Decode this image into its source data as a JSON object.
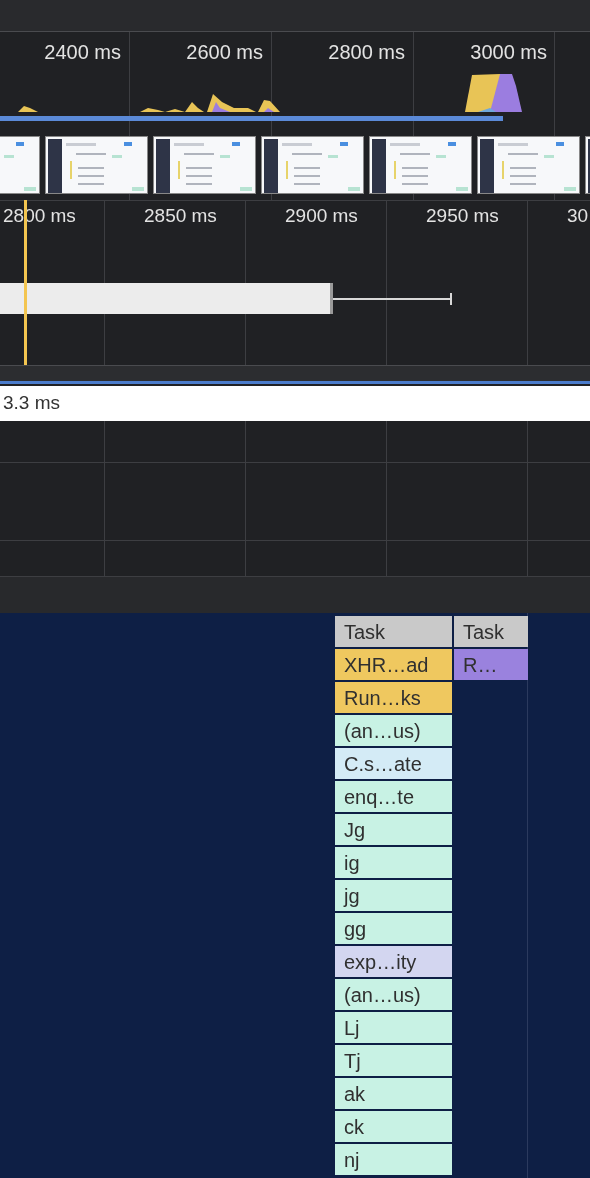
{
  "overview": {
    "ticks": [
      "2400 ms",
      "2600 ms",
      "2800 ms",
      "3000 ms"
    ],
    "progress": {
      "level": 0.853
    },
    "filmstrip": [
      {
        "kind": "picture"
      },
      {
        "kind": "picture"
      },
      {
        "kind": "picture"
      },
      {
        "kind": "picture"
      },
      {
        "kind": "picture"
      },
      {
        "kind": "picture"
      },
      {
        "kind": "picture"
      }
    ]
  },
  "ruler": {
    "ticks": [
      "2800 ms",
      "2850 ms",
      "2900 ms",
      "2950 ms",
      "30"
    ]
  },
  "timing": {
    "label": "3.3 ms"
  },
  "flame": {
    "columns": [
      {
        "entries": [
          {
            "label": "Task",
            "color": "#c9c9c9"
          },
          {
            "label": "XHR…ad",
            "color": "#efc85f"
          },
          {
            "label": "Run…ks",
            "color": "#efc85f"
          },
          {
            "label": "(an…us)",
            "color": "#c8f2e4"
          },
          {
            "label": "C.s…ate",
            "color": "#d4ebf6"
          },
          {
            "label": "enq…te",
            "color": "#c8f2e4"
          },
          {
            "label": "Jg",
            "color": "#c8f2e4"
          },
          {
            "label": "ig",
            "color": "#c8f2e4"
          },
          {
            "label": "jg",
            "color": "#c8f2e4"
          },
          {
            "label": "gg",
            "color": "#c8f2e4"
          },
          {
            "label": "exp…ity",
            "color": "#d3d6f0"
          },
          {
            "label": "(an…us)",
            "color": "#c8f2e4"
          },
          {
            "label": "Lj",
            "color": "#c8f2e4"
          },
          {
            "label": "Tj",
            "color": "#c8f2e4"
          },
          {
            "label": "ak",
            "color": "#c8f2e4"
          },
          {
            "label": "ck",
            "color": "#c8f2e4"
          },
          {
            "label": "nj",
            "color": "#c8f2e4"
          }
        ]
      },
      {
        "entries": [
          {
            "label": "Task",
            "color": "#c9c9c9"
          },
          {
            "label": "R…",
            "color": "#9a82de"
          }
        ]
      }
    ]
  }
}
